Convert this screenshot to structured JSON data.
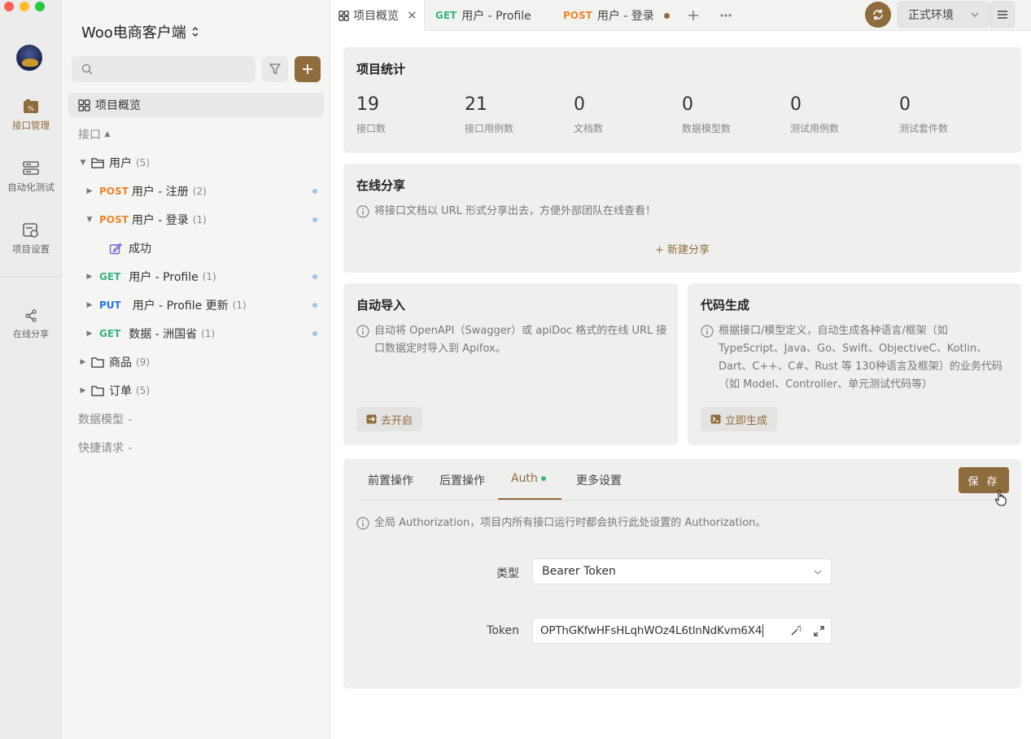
{
  "rail": {
    "items": [
      {
        "label": "接口管理"
      },
      {
        "label": "自动化测试"
      },
      {
        "label": "项目设置"
      },
      {
        "label": "在线分享"
      }
    ]
  },
  "sidebar": {
    "project_title": "Woo电商客户端",
    "search_placeholder": "",
    "overview_label": "项目概览",
    "section_api": "接口",
    "folder_user": {
      "name": "用户",
      "count": "(5)"
    },
    "apis": [
      {
        "method": "POST",
        "name": "用户 - 注册",
        "count": "(2)"
      },
      {
        "method": "POST",
        "name": "用户 - 登录",
        "count": "(1)"
      },
      {
        "name": "成功"
      },
      {
        "method": "GET",
        "name": "用户 - Profile",
        "count": "(1)"
      },
      {
        "method": "PUT",
        "name": "用户 - Profile 更新",
        "count": "(1)"
      },
      {
        "method": "GET",
        "name": "数据 - 洲国省",
        "count": "(1)"
      }
    ],
    "folder_goods": {
      "name": "商品",
      "count": "(9)"
    },
    "folder_orders": {
      "name": "订单",
      "count": "(5)"
    },
    "section_models": "数据模型",
    "section_quick": "快捷请求"
  },
  "tabs": [
    {
      "label": "项目概览"
    },
    {
      "method": "GET",
      "label": "用户 - Profile"
    },
    {
      "method": "POST",
      "label": "用户 - 登录"
    }
  ],
  "environment": {
    "selected": "正式环境"
  },
  "stats": {
    "title": "项目统计",
    "items": [
      {
        "value": "19",
        "label": "接口数"
      },
      {
        "value": "21",
        "label": "接口用例数"
      },
      {
        "value": "0",
        "label": "文档数"
      },
      {
        "value": "0",
        "label": "数据模型数"
      },
      {
        "value": "0",
        "label": "测试用例数"
      },
      {
        "value": "0",
        "label": "测试套件数"
      }
    ]
  },
  "share": {
    "title": "在线分享",
    "desc": "将接口文档以 URL 形式分享出去，方便外部团队在线查看！",
    "new_label": "+ 新建分享"
  },
  "auto_import": {
    "title": "自动导入",
    "desc": "自动将 OpenAPI（Swagger）或 apiDoc 格式的在线 URL 接口数据定时导入到 Apifox。",
    "button": "去开启"
  },
  "codegen": {
    "title": "代码生成",
    "desc": "根据接口/模型定义，自动生成各种语言/框架（如 TypeScript、Java、Go、Swift、ObjectiveC、Kotlin、Dart、C++、C#、Rust 等 130种语言及框架）的业务代码（如 Model、Controller、单元测试代码等）",
    "button": "立即生成"
  },
  "settings": {
    "tabs": [
      "前置操作",
      "后置操作",
      "Auth",
      "更多设置"
    ],
    "save_label": "保 存",
    "auth_info": "全局 Authorization，项目内所有接口运行时都会执行此处设置的 Authorization。",
    "type_label": "类型",
    "type_value": "Bearer Token",
    "token_label": "Token",
    "token_value": "OPThGKfwHFsHLqhWOz4L6tlnNdKvm6X4"
  },
  "colors": {
    "accent": "#8e6c3e",
    "post": "#e8862d",
    "get": "#36b37e",
    "put": "#2d74d9"
  }
}
